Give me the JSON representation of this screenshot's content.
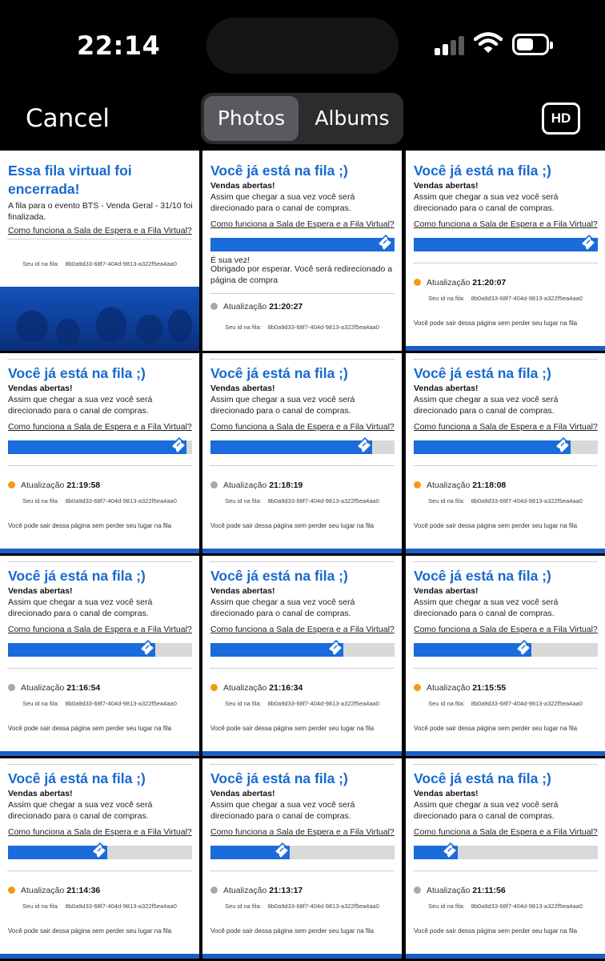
{
  "status_bar": {
    "time": "22:14"
  },
  "nav": {
    "cancel_label": "Cancel",
    "tabs": [
      "Photos",
      "Albums"
    ],
    "selected_tab": "Photos",
    "hd_label": "HD"
  },
  "strings": {
    "queue_title": "Você já está na fila ;)",
    "sales_open": "Vendas abertas!",
    "sales_desc": "Assim que chegar a sua vez você será direcionado para o canal de compras.",
    "help_link": "Como funciona a Sala de Espera e a Fila Virtual?",
    "update_label": "Atualização",
    "id_label": "Seu id na fila:",
    "queue_id": "8b0a9d33-68f7-404d-9813-a322f5ea4aa0",
    "leave_note": "Você pode sair dessa página sem perder seu lugar na fila"
  },
  "closed_tile": {
    "title": "Essa fila virtual foi encerrada!",
    "desc": "A fila para o evento BTS - Venda Geral - 31/10 foi finalizada.",
    "help_link": "Como funciona a Sala de Espera e a Fila Virtual?",
    "id_label": "Seu id na fila:",
    "queue_id": "8b0a9d33-68f7-404d-9813-a322f5ea4aa0"
  },
  "your_turn_tile": {
    "turn_msg": "É sua vez!",
    "redirect_msg": "Obrigado por esperar. Você será redirecionado a página de compra",
    "update_time": "21:20:27",
    "dot": "gray",
    "progress": 1.0
  },
  "tiles": [
    {
      "update_time": "21:20:07",
      "dot": "orange",
      "progress": 1.0
    },
    {
      "update_time": "21:19:58",
      "dot": "orange",
      "progress": 0.97
    },
    {
      "update_time": "21:18:19",
      "dot": "gray",
      "progress": 0.88
    },
    {
      "update_time": "21:18:08",
      "dot": "orange",
      "progress": 0.85
    },
    {
      "update_time": "21:16:54",
      "dot": "gray",
      "progress": 0.8
    },
    {
      "update_time": "21:16:34",
      "dot": "orange",
      "progress": 0.72
    },
    {
      "update_time": "21:15:55",
      "dot": "orange",
      "progress": 0.64
    },
    {
      "update_time": "21:14:36",
      "dot": "orange",
      "progress": 0.54
    },
    {
      "update_time": "21:13:17",
      "dot": "gray",
      "progress": 0.43
    },
    {
      "update_time": "21:11:56",
      "dot": "gray",
      "progress": 0.24
    }
  ],
  "colors": {
    "brand_blue": "#1769cf",
    "bar_blue": "#1a6bdc",
    "dot_orange": "#f39a12",
    "dot_gray": "#a9a9a9"
  }
}
